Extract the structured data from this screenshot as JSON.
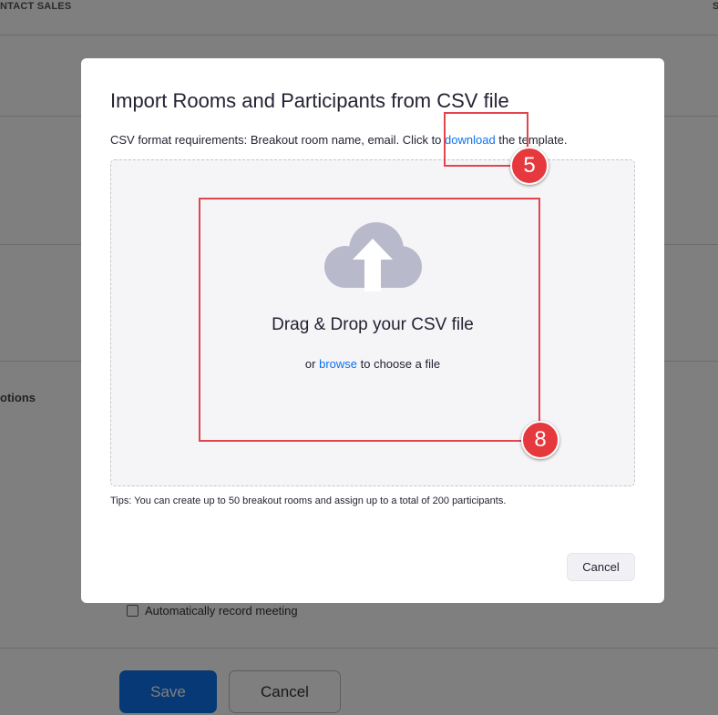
{
  "background": {
    "topbar_left_text": "NTACT SALES",
    "topbar_right_text": "S",
    "section_label": "otions",
    "auto_record_label": "Automatically record meeting",
    "save_label": "Save",
    "cancel_label": "Cancel"
  },
  "modal": {
    "title": "Import Rooms and Participants from CSV file",
    "requirements_prefix": "CSV format requirements: Breakout room name, email. Click to ",
    "download_link": "download",
    "requirements_suffix": " the template.",
    "dropzone": {
      "icon": "cloud-upload-icon",
      "title": "Drag & Drop your CSV file",
      "sub_prefix": "or ",
      "browse_link": "browse",
      "sub_suffix": " to choose a file"
    },
    "tips": "Tips: You can create up to 50 breakout rooms and assign up to a total of 200 participants.",
    "cancel_label": "Cancel"
  },
  "annotations": {
    "download_step": "5",
    "dropzone_step": "8"
  },
  "colors": {
    "link": "#0e72ed",
    "highlight": "#e2454d",
    "icon": "#b9b9cc"
  }
}
